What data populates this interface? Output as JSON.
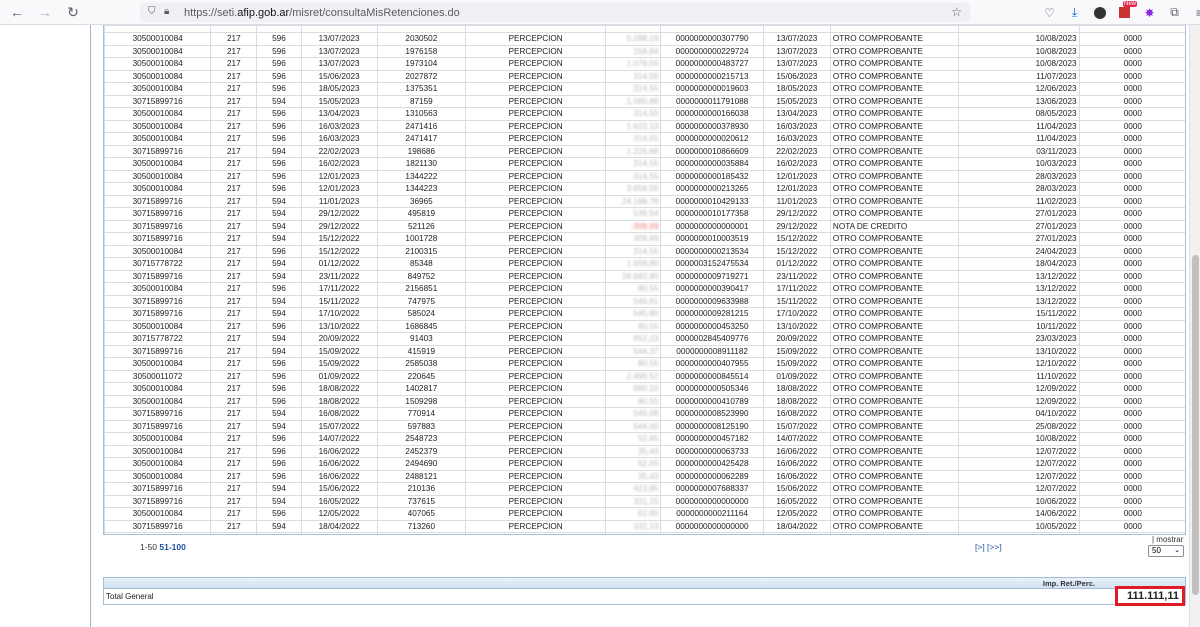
{
  "browser": {
    "url_prefix": "https://seti.",
    "url_domain": "afip.gob.ar",
    "url_path": "/misret/consultaMisRetenciones.do",
    "new_badge": "New"
  },
  "rows": [
    [
      "30500010084",
      "217",
      "596",
      "13/07/2023",
      "2030502",
      "PERCEPCION",
      "5.288,19",
      "0000000000307790",
      "13/07/2023",
      "OTRO COMPROBANTE",
      "10/08/2023",
      "0000"
    ],
    [
      "30500010084",
      "217",
      "596",
      "13/07/2023",
      "1976158",
      "PERCEPCION",
      "158,84",
      "0000000000229724",
      "13/07/2023",
      "OTRO COMPROBANTE",
      "10/08/2023",
      "0000"
    ],
    [
      "30500010084",
      "217",
      "596",
      "13/07/2023",
      "1973104",
      "PERCEPCION",
      "1.079,55",
      "0000000000483727",
      "13/07/2023",
      "OTRO COMPROBANTE",
      "10/08/2023",
      "0000"
    ],
    [
      "30500010084",
      "217",
      "596",
      "15/06/2023",
      "2027872",
      "PERCEPCION",
      "314,55",
      "0000000000215713",
      "15/06/2023",
      "OTRO COMPROBANTE",
      "11/07/2023",
      "0000"
    ],
    [
      "30500010084",
      "217",
      "596",
      "18/05/2023",
      "1375351",
      "PERCEPCION",
      "314,55",
      "0000000000019603",
      "18/05/2023",
      "OTRO COMPROBANTE",
      "12/06/2023",
      "0000"
    ],
    [
      "30715899716",
      "217",
      "594",
      "15/05/2023",
      "87159",
      "PERCEPCION",
      "1.080,88",
      "0000000011791088",
      "15/05/2023",
      "OTRO COMPROBANTE",
      "13/06/2023",
      "0000"
    ],
    [
      "30500010084",
      "217",
      "596",
      "13/04/2023",
      "1310563",
      "PERCEPCION",
      "314,55",
      "0000000000166038",
      "13/04/2023",
      "OTRO COMPROBANTE",
      "08/05/2023",
      "0000"
    ],
    [
      "30500010084",
      "217",
      "596",
      "16/03/2023",
      "2471416",
      "PERCEPCION",
      "1.622,13",
      "0000000000378930",
      "16/03/2023",
      "OTRO COMPROBANTE",
      "11/04/2023",
      "0000"
    ],
    [
      "30500010084",
      "217",
      "596",
      "16/03/2023",
      "2471417",
      "PERCEPCION",
      "314,55",
      "0000000000020612",
      "16/03/2023",
      "OTRO COMPROBANTE",
      "11/04/2023",
      "0000"
    ],
    [
      "30715899716",
      "217",
      "594",
      "22/02/2023",
      "198686",
      "PERCEPCION",
      "1.226,68",
      "0000000010866609",
      "22/02/2023",
      "OTRO COMPROBANTE",
      "03/11/2023",
      "0000"
    ],
    [
      "30500010084",
      "217",
      "596",
      "16/02/2023",
      "1821130",
      "PERCEPCION",
      "314,55",
      "0000000000035884",
      "16/02/2023",
      "OTRO COMPROBANTE",
      "10/03/2023",
      "0000"
    ],
    [
      "30500010084",
      "217",
      "596",
      "12/01/2023",
      "1344222",
      "PERCEPCION",
      "314,55",
      "0000000000185432",
      "12/01/2023",
      "OTRO COMPROBANTE",
      "28/03/2023",
      "0000"
    ],
    [
      "30500010084",
      "217",
      "596",
      "12/01/2023",
      "1344223",
      "PERCEPCION",
      "3.658,55",
      "0000000000213265",
      "12/01/2023",
      "OTRO COMPROBANTE",
      "28/03/2023",
      "0000"
    ],
    [
      "30715899716",
      "217",
      "594",
      "11/01/2023",
      "36965",
      "PERCEPCION",
      "24.188,78",
      "0000000010429133",
      "11/01/2023",
      "OTRO COMPROBANTE",
      "11/02/2023",
      "0000"
    ],
    [
      "30715899716",
      "217",
      "594",
      "29/12/2022",
      "495819",
      "PERCEPCION",
      "539,54",
      "0000000010177358",
      "29/12/2022",
      "OTRO COMPROBANTE",
      "27/01/2023",
      "0000"
    ],
    [
      "30715899716",
      "217",
      "594",
      "29/12/2022",
      "521126",
      "PERCEPCION",
      "-309,69",
      "0000000000000001",
      "29/12/2022",
      "NOTA DE CREDITO",
      "27/01/2023",
      "0000"
    ],
    [
      "30715899716",
      "217",
      "594",
      "15/12/2022",
      "1001728",
      "PERCEPCION",
      "309,69",
      "0000000010003519",
      "15/12/2022",
      "OTRO COMPROBANTE",
      "27/01/2023",
      "0000"
    ],
    [
      "30500010084",
      "217",
      "596",
      "15/12/2022",
      "2100315",
      "PERCEPCION",
      "314,55",
      "0000000000213534",
      "15/12/2022",
      "OTRO COMPROBANTE",
      "24/04/2023",
      "0000"
    ],
    [
      "30715778722",
      "217",
      "594",
      "01/12/2022",
      "85348",
      "PERCEPCION",
      "1.658,80",
      "0000003152475534",
      "01/12/2022",
      "OTRO COMPROBANTE",
      "18/04/2023",
      "0000"
    ],
    [
      "30715899716",
      "217",
      "594",
      "23/11/2022",
      "849752",
      "PERCEPCION",
      "28.683,80",
      "0000000009719271",
      "23/11/2022",
      "OTRO COMPROBANTE",
      "13/12/2022",
      "0000"
    ],
    [
      "30500010084",
      "217",
      "596",
      "17/11/2022",
      "2156851",
      "PERCEPCION",
      "80,55",
      "0000000000390417",
      "17/11/2022",
      "OTRO COMPROBANTE",
      "13/12/2022",
      "0000"
    ],
    [
      "30715899716",
      "217",
      "594",
      "15/11/2022",
      "747975",
      "PERCEPCION",
      "546,81",
      "0000000009633988",
      "15/11/2022",
      "OTRO COMPROBANTE",
      "13/12/2022",
      "0000"
    ],
    [
      "30715899716",
      "217",
      "594",
      "17/10/2022",
      "585024",
      "PERCEPCION",
      "545,90",
      "0000000009281215",
      "17/10/2022",
      "OTRO COMPROBANTE",
      "15/11/2022",
      "0000"
    ],
    [
      "30500010084",
      "217",
      "596",
      "13/10/2022",
      "1686845",
      "PERCEPCION",
      "80,55",
      "0000000000453250",
      "13/10/2022",
      "OTRO COMPROBANTE",
      "10/11/2022",
      "0000"
    ],
    [
      "30715778722",
      "217",
      "594",
      "20/09/2022",
      "91403",
      "PERCEPCION",
      "652,23",
      "0000002845409776",
      "20/09/2022",
      "OTRO COMPROBANTE",
      "23/03/2023",
      "0000"
    ],
    [
      "30715899716",
      "217",
      "594",
      "15/09/2022",
      "415919",
      "PERCEPCION",
      "544,37",
      "0000000008911182",
      "15/09/2022",
      "OTRO COMPROBANTE",
      "13/10/2022",
      "0000"
    ],
    [
      "30500010084",
      "217",
      "596",
      "15/09/2022",
      "2585038",
      "PERCEPCION",
      "80,55",
      "0000000000407955",
      "15/09/2022",
      "OTRO COMPROBANTE",
      "12/10/2022",
      "0000"
    ],
    [
      "30500011072",
      "217",
      "596",
      "01/09/2022",
      "220645",
      "PERCEPCION",
      "2.499,52",
      "0000000000845514",
      "01/09/2022",
      "OTRO COMPROBANTE",
      "11/10/2022",
      "0000"
    ],
    [
      "30500010084",
      "217",
      "596",
      "18/08/2022",
      "1402817",
      "PERCEPCION",
      "880,10",
      "0000000000505346",
      "18/08/2022",
      "OTRO COMPROBANTE",
      "12/09/2022",
      "0000"
    ],
    [
      "30500010084",
      "217",
      "596",
      "18/08/2022",
      "1509298",
      "PERCEPCION",
      "80,55",
      "0000000000410789",
      "18/08/2022",
      "OTRO COMPROBANTE",
      "12/09/2022",
      "0000"
    ],
    [
      "30715899716",
      "217",
      "594",
      "16/08/2022",
      "770914",
      "PERCEPCION",
      "545,08",
      "0000000008523990",
      "16/08/2022",
      "OTRO COMPROBANTE",
      "04/10/2022",
      "0000"
    ],
    [
      "30715899716",
      "217",
      "594",
      "15/07/2022",
      "597883",
      "PERCEPCION",
      "544,00",
      "0000000008125190",
      "15/07/2022",
      "OTRO COMPROBANTE",
      "25/08/2022",
      "0000"
    ],
    [
      "30500010084",
      "217",
      "596",
      "14/07/2022",
      "2548723",
      "PERCEPCION",
      "52,65",
      "0000000000457182",
      "14/07/2022",
      "OTRO COMPROBANTE",
      "10/08/2022",
      "0000"
    ],
    [
      "30500010084",
      "217",
      "596",
      "16/06/2022",
      "2452379",
      "PERCEPCION",
      "35,43",
      "0000000000063733",
      "16/06/2022",
      "OTRO COMPROBANTE",
      "12/07/2022",
      "0000"
    ],
    [
      "30500010084",
      "217",
      "596",
      "16/06/2022",
      "2494690",
      "PERCEPCION",
      "52,65",
      "0000000000425428",
      "16/06/2022",
      "OTRO COMPROBANTE",
      "12/07/2022",
      "0000"
    ],
    [
      "30500010084",
      "217",
      "596",
      "16/06/2022",
      "2488121",
      "PERCEPCION",
      "35,43",
      "0000000000062289",
      "16/06/2022",
      "OTRO COMPROBANTE",
      "12/07/2022",
      "0000"
    ],
    [
      "30715899716",
      "217",
      "594",
      "15/06/2022",
      "210136",
      "PERCEPCION",
      "423,85",
      "0000000007688337",
      "15/06/2022",
      "OTRO COMPROBANTE",
      "12/07/2022",
      "0000"
    ],
    [
      "30715899716",
      "217",
      "594",
      "16/05/2022",
      "737615",
      "PERCEPCION",
      "331,15",
      "0000000000000000",
      "16/05/2022",
      "OTRO COMPROBANTE",
      "10/06/2022",
      "0000"
    ],
    [
      "30500010084",
      "217",
      "596",
      "12/05/2022",
      "407065",
      "PERCEPCION",
      "62,65",
      "0000000000211164",
      "12/05/2022",
      "OTRO COMPROBANTE",
      "14/06/2022",
      "0000"
    ],
    [
      "30715899716",
      "217",
      "594",
      "18/04/2022",
      "713260",
      "PERCEPCION",
      "332,13",
      "0000000000000000",
      "18/04/2022",
      "OTRO COMPROBANTE",
      "10/05/2022",
      "0000"
    ],
    [
      "30500010084",
      "217",
      "596",
      "13/04/2022",
      "2229448",
      "PERCEPCION",
      "62,65",
      "0000000000326926",
      "13/04/2022",
      "OTRO COMPROBANTE",
      "10/05/2022",
      "0000"
    ]
  ],
  "pager": {
    "range_text": "1-50",
    "next_range_link": "51-100",
    "next_links": "[>] [>>]",
    "mostrar_label": "| mostrar",
    "page_size": "50"
  },
  "totals": {
    "column_header": "Imp. Ret./Perc.",
    "label": "Total General",
    "value": "111.111,11"
  }
}
